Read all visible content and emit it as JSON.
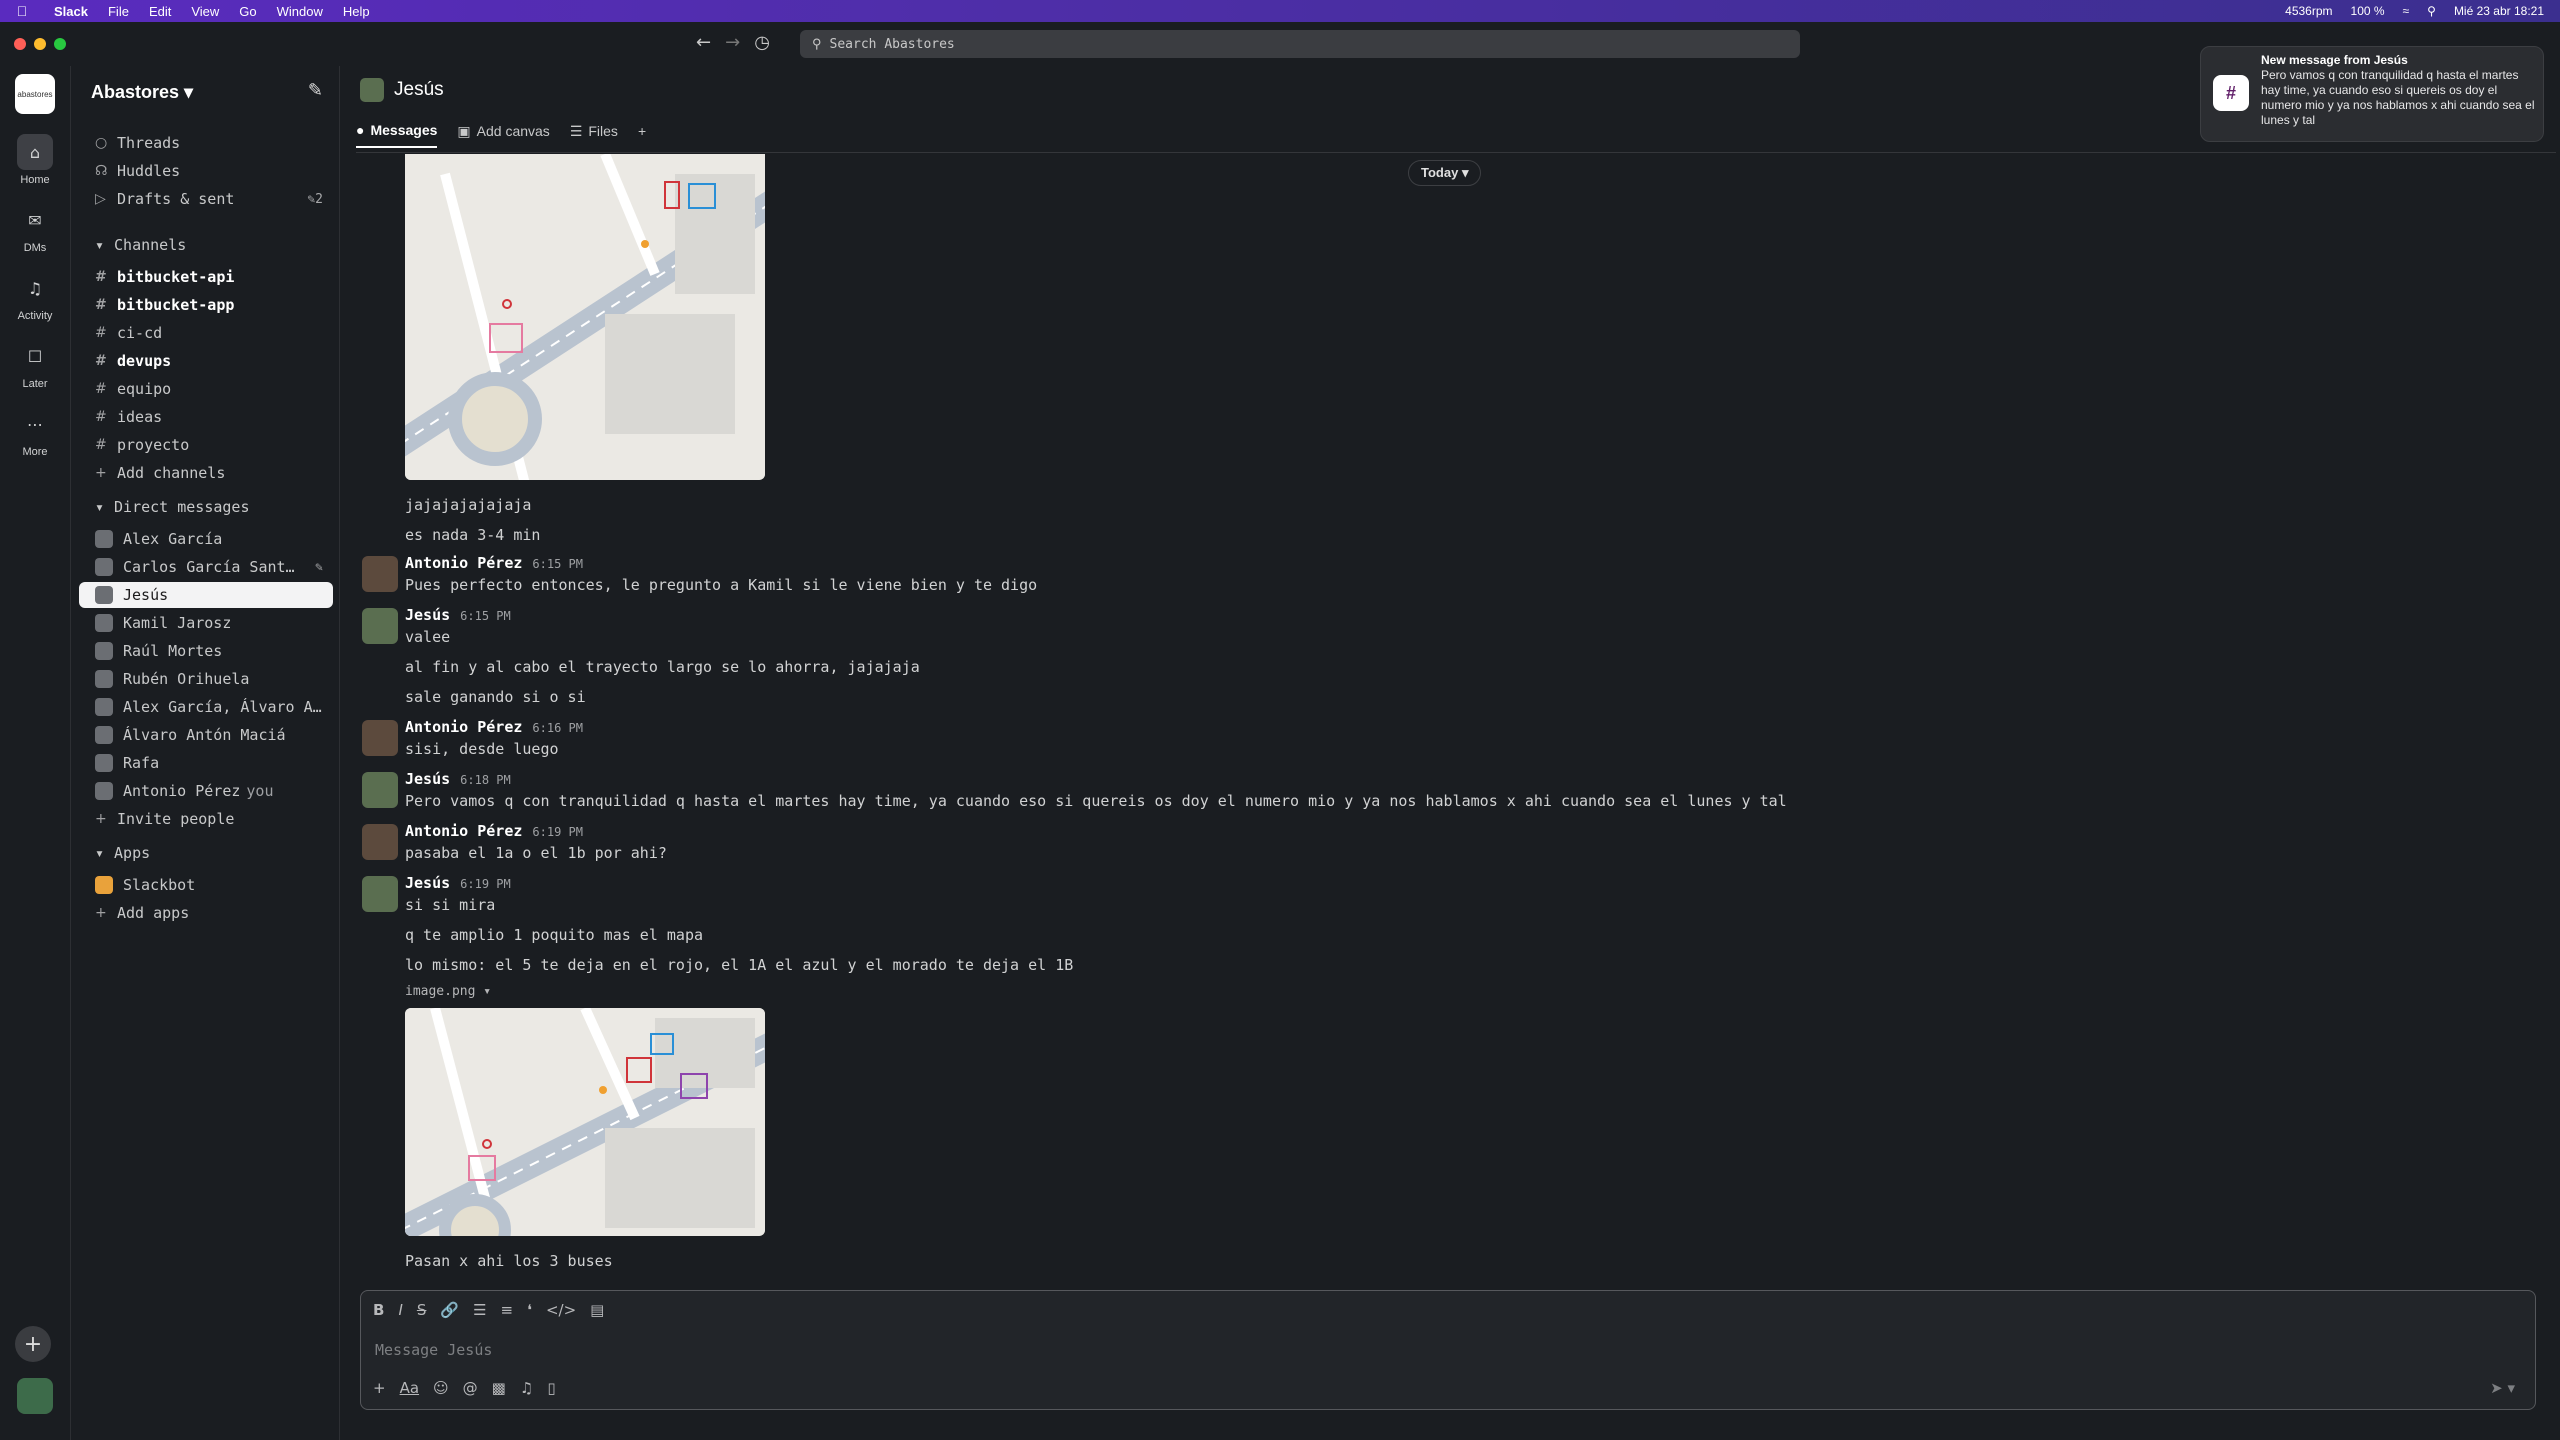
{
  "menubar": {
    "app": "Slack",
    "items": [
      "File",
      "Edit",
      "View",
      "Go",
      "Window",
      "Help"
    ],
    "status": {
      "rpm": "4536rpm",
      "battery": "100 %",
      "datetime": "Mié 23 abr 18:21"
    }
  },
  "search": {
    "placeholder": "Search Abastores"
  },
  "rail": {
    "workspace_logo_text": "abastores",
    "items": [
      {
        "label": "Home",
        "icon": "home-icon"
      },
      {
        "label": "DMs",
        "icon": "dms-icon"
      },
      {
        "label": "Activity",
        "icon": "bell-icon"
      },
      {
        "label": "Later",
        "icon": "bookmark-icon"
      },
      {
        "label": "More",
        "icon": "more-icon"
      }
    ]
  },
  "sidebar": {
    "workspace": "Abastores",
    "top": [
      {
        "label": "Threads",
        "icon": "threads-icon"
      },
      {
        "label": "Huddles",
        "icon": "headphones-icon"
      },
      {
        "label": "Drafts & sent",
        "icon": "send-icon",
        "count": "2"
      }
    ],
    "channels_title": "Channels",
    "channels": [
      {
        "name": "bitbucket-api",
        "bold": true
      },
      {
        "name": "bitbucket-app",
        "bold": true
      },
      {
        "name": "ci-cd",
        "bold": false
      },
      {
        "name": "devups",
        "bold": true
      },
      {
        "name": "equipo",
        "bold": false
      },
      {
        "name": "ideas",
        "bold": false
      },
      {
        "name": "proyecto",
        "bold": false
      }
    ],
    "add_channels": "Add channels",
    "dms_title": "Direct messages",
    "dms": [
      {
        "name": "Alex García"
      },
      {
        "name": "Carlos García Sant…"
      },
      {
        "name": "Jesús"
      },
      {
        "name": "Kamil Jarosz"
      },
      {
        "name": "Raúl Mortes"
      },
      {
        "name": "Rubén Orihuela"
      },
      {
        "name": "Alex García, Álvaro A…"
      },
      {
        "name": "Álvaro Antón Maciá"
      },
      {
        "name": "Rafa"
      },
      {
        "name": "Antonio Pérez"
      }
    ],
    "you_label": "you",
    "invite": "Invite people",
    "apps_title": "Apps",
    "apps": [
      {
        "name": "Slackbot"
      }
    ],
    "add_apps": "Add apps"
  },
  "channel": {
    "name": "Jesús",
    "tabs": [
      "Messages",
      "Add canvas",
      "Files"
    ],
    "date_divider": "Today"
  },
  "messages": [
    {
      "text": "jajajajajajaja"
    },
    {
      "text": "es nada 3-4 min"
    },
    {
      "author": "Antonio Pérez",
      "time": "6:15 PM",
      "text": "Pues perfecto entonces, le pregunto a Kamil si le viene bien y te digo"
    },
    {
      "author": "Jesús",
      "time": "6:15 PM",
      "text": "valee"
    },
    {
      "text": "al fin y al cabo el trayecto largo se lo ahorra, jajajaja"
    },
    {
      "text": "sale ganando si o si"
    },
    {
      "author": "Antonio Pérez",
      "time": "6:16 PM",
      "text": "sisi, desde luego"
    },
    {
      "author": "Jesús",
      "time": "6:18 PM",
      "text": "Pero vamos q con tranquilidad q hasta el martes hay time, ya cuando eso si quereis os doy el numero mio y ya nos hablamos x ahi cuando sea el lunes y tal"
    },
    {
      "author": "Antonio Pérez",
      "time": "6:19 PM",
      "text": "pasaba el 1a o el 1b por ahi?"
    },
    {
      "author": "Jesús",
      "time": "6:19 PM",
      "text": "si si mira"
    },
    {
      "text": "q te amplio 1 poquito mas el mapa"
    },
    {
      "text": "lo mismo: el 5 te deja en el rojo, el 1A el azul y el morado te deja el 1B"
    },
    {
      "file": "image.png"
    },
    {
      "text": "Pasan x ahi los 3 buses"
    }
  ],
  "composer": {
    "placeholder": "Message Jesús"
  },
  "notification": {
    "title": "New message from Jesús",
    "body": "Pero vamos q con tranquilidad q hasta el martes hay time, ya cuando eso si quereis os doy el numero mio y ya nos hablamos x ahi cuando sea el lunes y tal"
  }
}
